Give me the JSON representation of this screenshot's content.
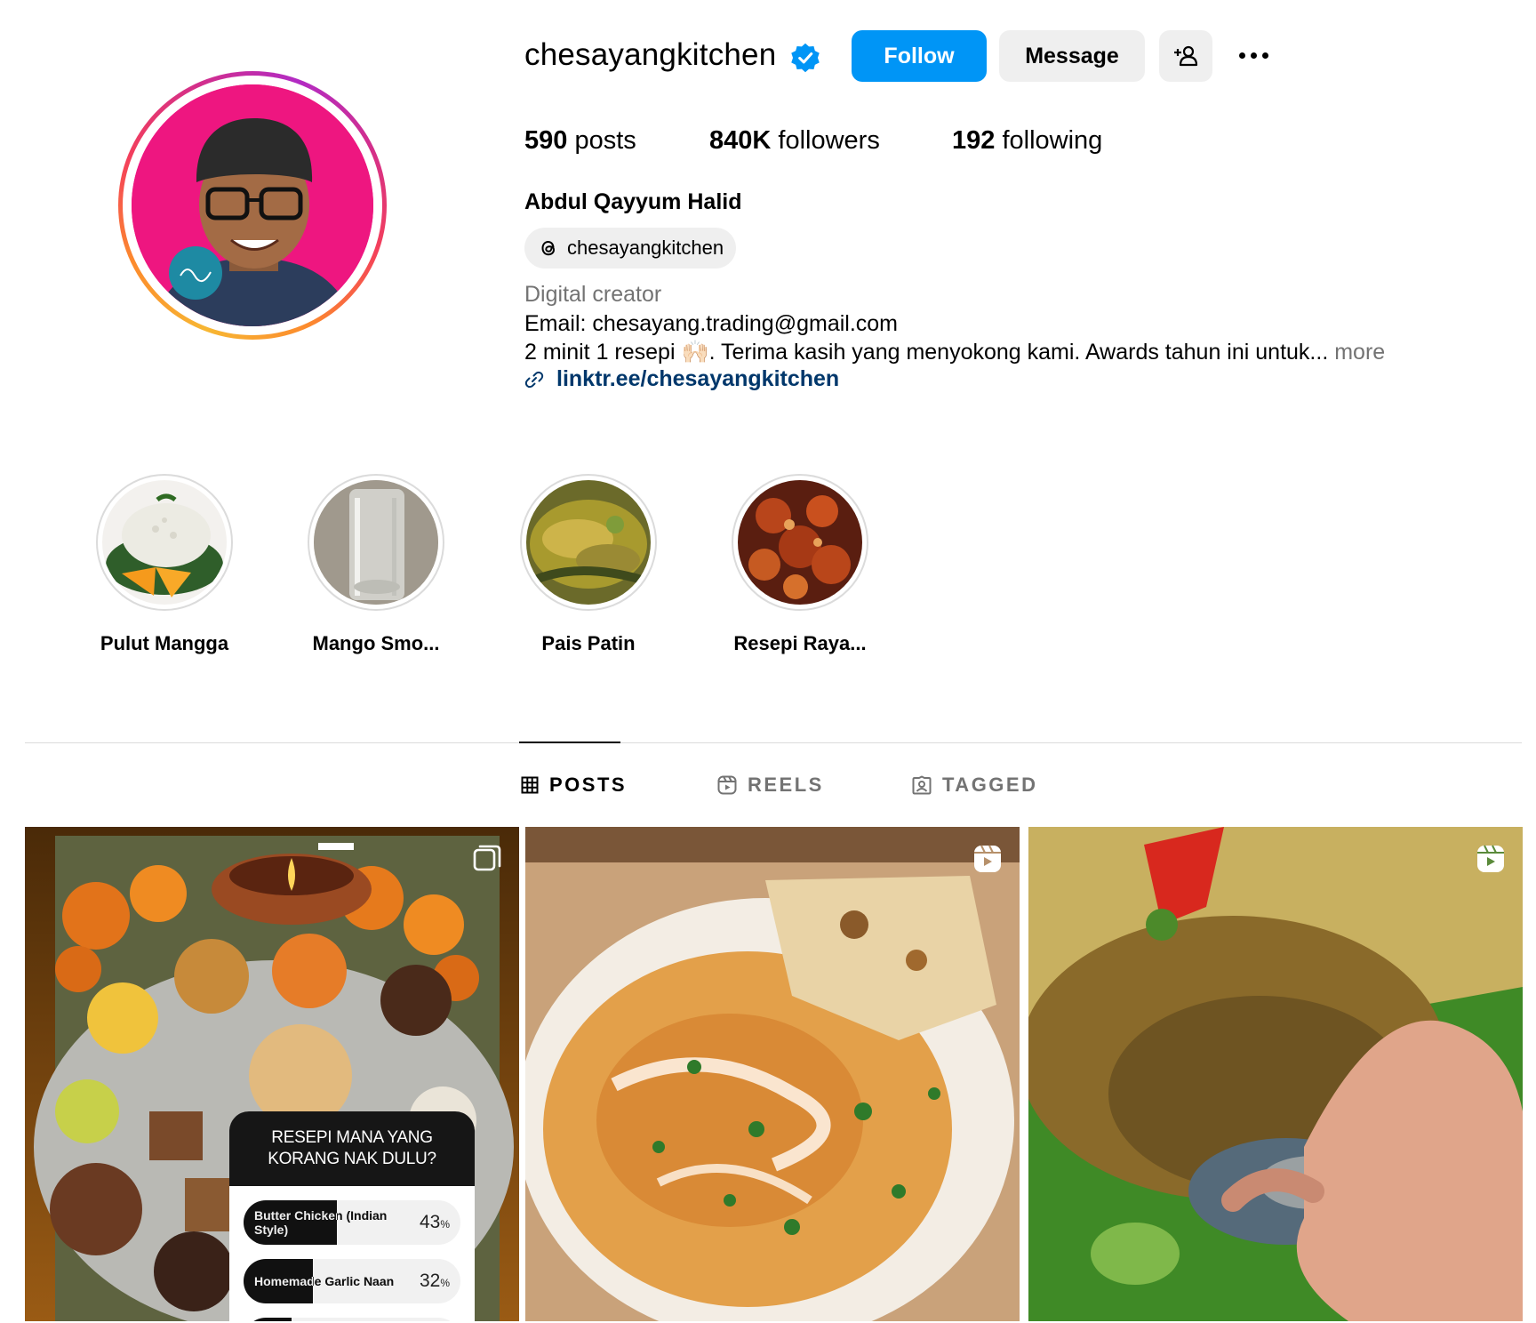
{
  "profile": {
    "username": "chesayangkitchen",
    "verified": true,
    "full_name": "Abdul Qayyum Halid",
    "threads_handle": "chesayangkitchen",
    "category": "Digital creator",
    "bio_email": "Email: chesayang.trading@gmail.com",
    "bio_text": "2 minit 1 resepi 🙌🏻. Terima kasih yang menyokong kami. Awards tahun ini untuk...",
    "bio_more": "more",
    "link": "linktr.ee/chesayangkitchen",
    "avatar_bg": "#ee1680"
  },
  "actions": {
    "follow_label": "Follow",
    "message_label": "Message",
    "follow_color": "#0095f6"
  },
  "stats": {
    "posts_count": "590",
    "posts_label": "posts",
    "followers_count": "840K",
    "followers_label": "followers",
    "following_count": "192",
    "following_label": "following"
  },
  "highlights": [
    {
      "label": "Pulut Mangga"
    },
    {
      "label": "Mango Smo..."
    },
    {
      "label": "Pais Patin"
    },
    {
      "label": "Resepi Raya..."
    }
  ],
  "tabs": [
    {
      "label": "POSTS",
      "icon": "grid-icon",
      "active": true
    },
    {
      "label": "REELS",
      "icon": "reels-icon",
      "active": false
    },
    {
      "label": "TAGGED",
      "icon": "tagged-icon",
      "active": false
    }
  ],
  "posts": [
    {
      "type": "carousel",
      "icon": "carousel-icon",
      "poll": {
        "question": "RESEPI MANA YANG KORANG NAK DULU?",
        "options": [
          {
            "text": "Butter Chicken (Indian Style)",
            "percent": 43
          },
          {
            "text": "Homemade Garlic Naan",
            "percent": 32
          }
        ]
      }
    },
    {
      "type": "reel",
      "icon": "reels-icon"
    },
    {
      "type": "reel",
      "icon": "reels-icon"
    }
  ]
}
